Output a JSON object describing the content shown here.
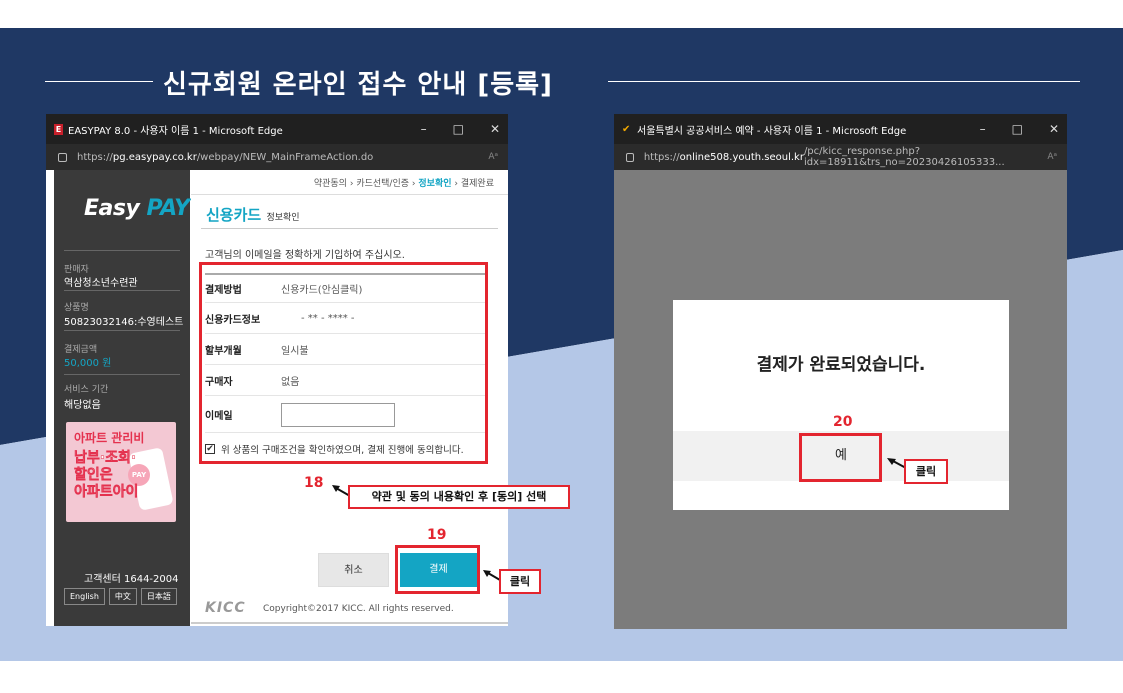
{
  "title": "신규회원 온라인 접수 안내 [등록]",
  "left_window": {
    "title": "EASYPAY 8.0 - 사용자 이름 1 - Microsoft Edge",
    "app_icon": "E",
    "url_prefix": "https://",
    "url_host": "pg.easypay.co.kr",
    "url_path": "/webpay/NEW_MainFrameAction.do",
    "reader_icon": "Aᵃ",
    "controls": [
      "–",
      "□",
      "✕"
    ],
    "sidebar": {
      "logo_a": "Easy ",
      "logo_b": "PAY",
      "seller_label": "판매자",
      "seller_value": "역삼청소년수련관",
      "product_label": "상품명",
      "product_value": "50823032146:수영테스트",
      "amount_label": "결제금액",
      "amount_value": "50,000 원",
      "period_label": "서비스 기간",
      "period_value": "해당없음",
      "ad_line1": "아파트 관리비",
      "ad_line2": "납부·조회·",
      "ad_line3": "할인은",
      "ad_line4": "아파트아이",
      "ad_badge": "PAY",
      "customer_center": "고객센터 1644-2004",
      "languages": [
        "English",
        "中文",
        "日本語"
      ]
    },
    "breadcrumb": {
      "step1": "약관동의",
      "step2": "카드선택/인증",
      "step3": "정보확인",
      "step4": "결제완료",
      "sep": "›"
    },
    "page_title": "신용카드",
    "page_subtitle": "정보확인",
    "guide": "고객님의 이메일을 정확하게 기입하여 주십시오.",
    "rows": [
      {
        "key": "결제방법",
        "value": "신용카드(안심클릭)"
      },
      {
        "key": "신용카드정보",
        "value": "-  ** - **** -"
      },
      {
        "key": "할부개월",
        "value": "일시불"
      },
      {
        "key": "구매자",
        "value": "없음"
      },
      {
        "key": "이메일",
        "value": ""
      }
    ],
    "agree_check": "✔",
    "agree_text": "위 상품의 구매조건을 확인하였으며, 결제 진행에 동의합니다.",
    "cancel_label": "취소",
    "pay_label": "결제",
    "footer_logo": "KICC",
    "copyright": "Copyright©2017 KICC. All rights reserved."
  },
  "right_window": {
    "title": "서울특별시 공공서비스 예약 - 사용자 이름 1 - Microsoft Edge",
    "url_prefix": "https://",
    "url_host": "online508.youth.seoul.kr",
    "url_path": "/pc/kicc_response.php?idx=18911&trs_no=20230426105333...",
    "reader_icon": "Aᵃ",
    "controls": [
      "–",
      "□",
      "✕"
    ],
    "modal_message": "결제가 완료되었습니다.",
    "yes_label": "예"
  },
  "annotations": {
    "step18_num": "18",
    "step18_text": "약관 및 동의 내용확인 후 [동의] 선택",
    "step19_num": "19",
    "step19_text": "클릭",
    "step20_num": "20",
    "step20_text": "클릭"
  },
  "colors": {
    "navy": "#1f3864",
    "light_blue": "#b4c7e7",
    "accent": "#14a5c4",
    "annotation_red": "#e3252f"
  }
}
